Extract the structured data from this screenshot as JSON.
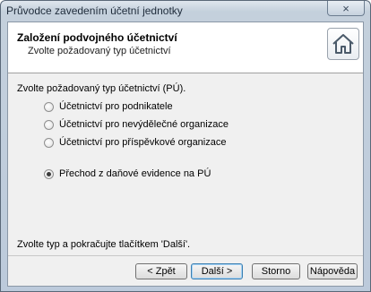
{
  "window": {
    "title": "Průvodce zavedením účetní jednotky",
    "close_symbol": "×"
  },
  "header": {
    "title": "Založení podvojného účetnictví",
    "subtitle": "Zvolte požadovaný typ účetnictví",
    "home_icon": "home-icon"
  },
  "content": {
    "prompt": "Zvolte požadovaný typ účetnictví (PÚ).",
    "options": [
      {
        "label": "Účetnictví pro podnikatele",
        "checked": false
      },
      {
        "label": "Účetnictví pro nevýdělečné organizace",
        "checked": false
      },
      {
        "label": "Účetnictví pro příspěvkové organizace",
        "checked": false
      },
      {
        "label": "Přechod z daňové evidence na PÚ",
        "checked": true
      }
    ],
    "hint": "Zvolte typ a pokračujte tlačítkem 'Další'."
  },
  "buttons": {
    "back": "< Zpět",
    "next": "Další >",
    "cancel": "Storno",
    "help": "Nápověda"
  }
}
